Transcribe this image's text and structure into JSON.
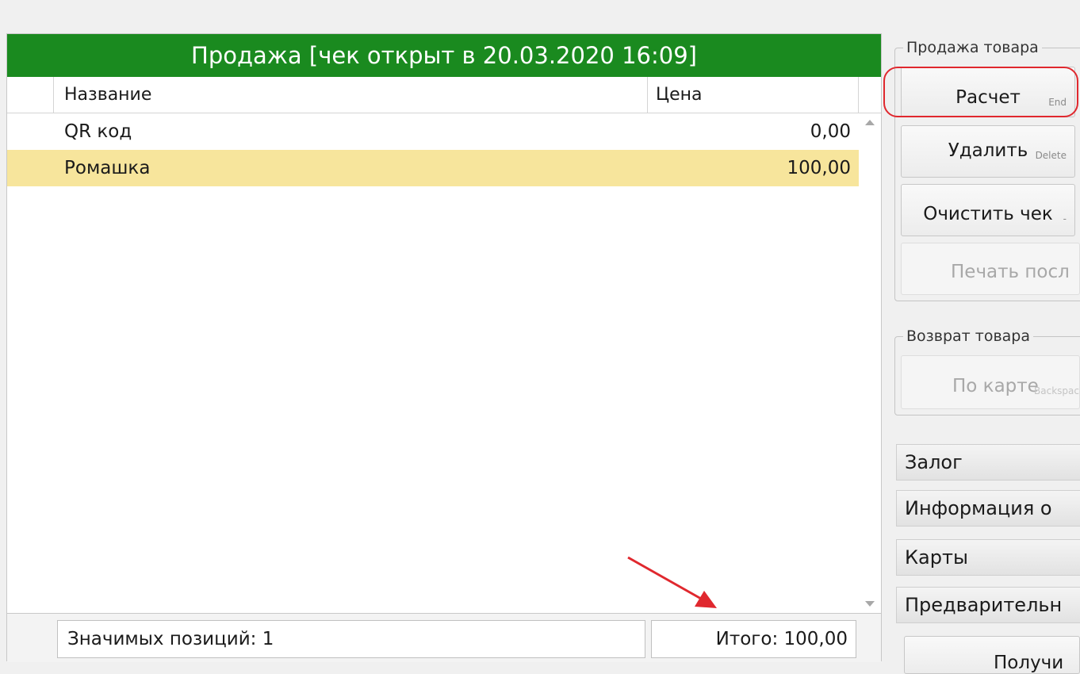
{
  "sale": {
    "title": "Продажа [чек открыт в 20.03.2020 16:09]",
    "columns": {
      "name": "Название",
      "price": "Цена"
    },
    "rows": [
      {
        "name": "QR код",
        "price": "0,00",
        "selected": false
      },
      {
        "name": "Ромашка",
        "price": "100,00",
        "selected": true
      }
    ],
    "footer": {
      "count": "Значимых позиций: 1",
      "total": "Итого: 100,00"
    }
  },
  "actions": {
    "sale_group": {
      "label": "Продажа товара",
      "calc": {
        "label": "Расчет",
        "hotkey": "End"
      },
      "delete": {
        "label": "Удалить",
        "hotkey": "Delete"
      },
      "clear": {
        "label": "Очистить чек",
        "hotkey": "-"
      },
      "print": {
        "label": "Печать посл"
      }
    },
    "return_group": {
      "label": "Возврат товара",
      "by_card": {
        "label": "По карте",
        "hotkey": "Backspac"
      }
    },
    "sections": [
      "Залог",
      "Информация о",
      "Карты",
      "Предварительн"
    ],
    "bottom_button": "Получи"
  },
  "colors": {
    "title_bg": "#1a8a1f",
    "selected_row": "#f7e59c",
    "annotation_red": "#e0282e"
  }
}
